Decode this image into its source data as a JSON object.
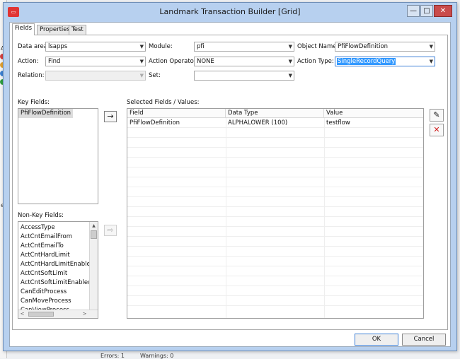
{
  "window": {
    "title": "Landmark Transaction Builder [Grid]"
  },
  "window_controls": {
    "minimize": "—",
    "maximize": "□",
    "close": "✕"
  },
  "tabs": [
    {
      "label": "Fields",
      "active": true
    },
    {
      "label": "Properties",
      "active": false
    },
    {
      "label": "Test",
      "active": false
    }
  ],
  "form": {
    "data_area": {
      "label": "Data area:",
      "value": "lsapps"
    },
    "module": {
      "label": "Module:",
      "value": "pfi"
    },
    "object_name": {
      "label": "Object Name:",
      "value": "PfiFlowDefinition"
    },
    "action": {
      "label": "Action:",
      "value": "Find"
    },
    "action_operator": {
      "label": "Action Operator:",
      "value": "NONE"
    },
    "action_type": {
      "label": "Action Type:",
      "value": "SingleRecordQuery"
    },
    "relation": {
      "label": "Relation:",
      "value": ""
    },
    "set": {
      "label": "Set:",
      "value": ""
    }
  },
  "key_fields": {
    "label": "Key Fields:",
    "items": [
      "PfiFlowDefinition"
    ]
  },
  "non_key_fields": {
    "label": "Non-Key Fields:",
    "items": [
      "AccessType",
      "ActCntEmailFrom",
      "ActCntEmailTo",
      "ActCntHardLimit",
      "ActCntHardLimitEnabled",
      "ActCntSoftLimit",
      "ActCntSoftLimitEnabled",
      "CanEditProcess",
      "CanMoveProcess",
      "CanViewProcess"
    ]
  },
  "selected_fields": {
    "label": "Selected Fields / Values:",
    "columns": [
      "Field",
      "Data Type",
      "Value"
    ],
    "rows": [
      [
        "PfiFlowDefinition",
        "ALPHALOWER (100)",
        "testflow"
      ]
    ]
  },
  "buttons": {
    "ok": "OK",
    "cancel": "Cancel"
  },
  "icons": {
    "add_arrow": "→",
    "add_arrow_disabled": "⇨",
    "edit": "✎",
    "delete": "✕",
    "dropdown": "▼",
    "scroll_up": "▲",
    "scroll_left": "<",
    "scroll_right": ">",
    "app": "▭"
  },
  "colors": {
    "selection": "#3399ff",
    "delete_icon": "#d02020",
    "window_frame": "#b7d0ef"
  },
  "background_app": {
    "frag_a": "A",
    "frag_b": "e",
    "status_errors": "Errors: 1",
    "status_warnings": "Warnings: 0"
  }
}
